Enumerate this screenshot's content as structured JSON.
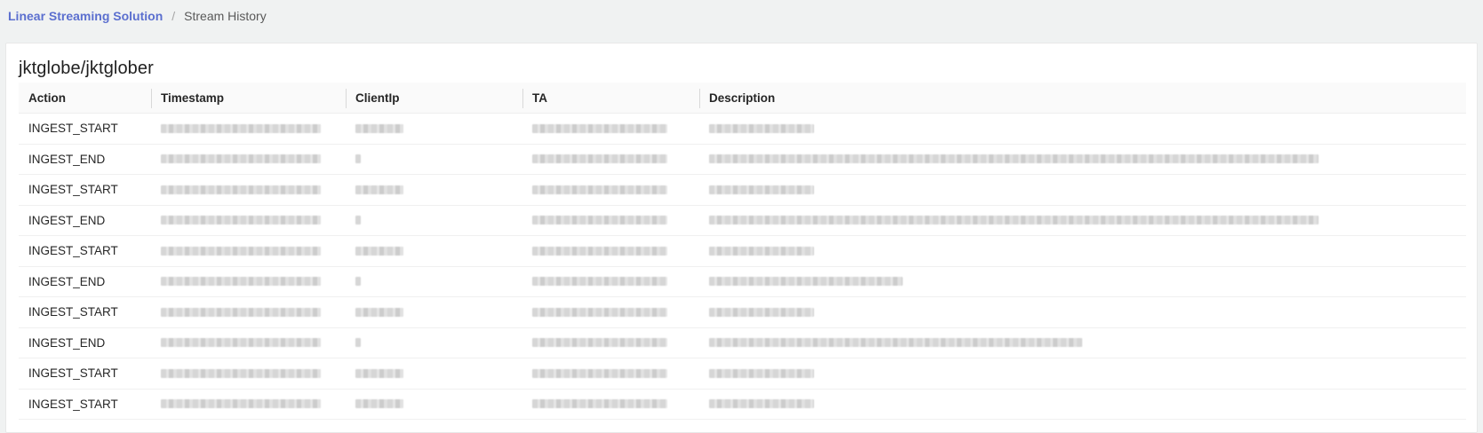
{
  "breadcrumb": {
    "root": "Linear Streaming Solution",
    "separator": "/",
    "current": "Stream History"
  },
  "card": {
    "title": "jktglobe/jktglober"
  },
  "table": {
    "columns": [
      "Action",
      "Timestamp",
      "ClientIp",
      "TA",
      "Description"
    ],
    "rows": [
      {
        "action": "INGEST_START"
      },
      {
        "action": "INGEST_END"
      },
      {
        "action": "INGEST_START"
      },
      {
        "action": "INGEST_END"
      },
      {
        "action": "INGEST_START"
      },
      {
        "action": "INGEST_END"
      },
      {
        "action": "INGEST_START"
      },
      {
        "action": "INGEST_END"
      },
      {
        "action": "INGEST_START"
      },
      {
        "action": "INGEST_START"
      }
    ]
  },
  "colors": {
    "accent": "#5b6fcf",
    "background": "#f0f2f2",
    "card": "#ffffff",
    "header_bg": "#fafafa"
  }
}
